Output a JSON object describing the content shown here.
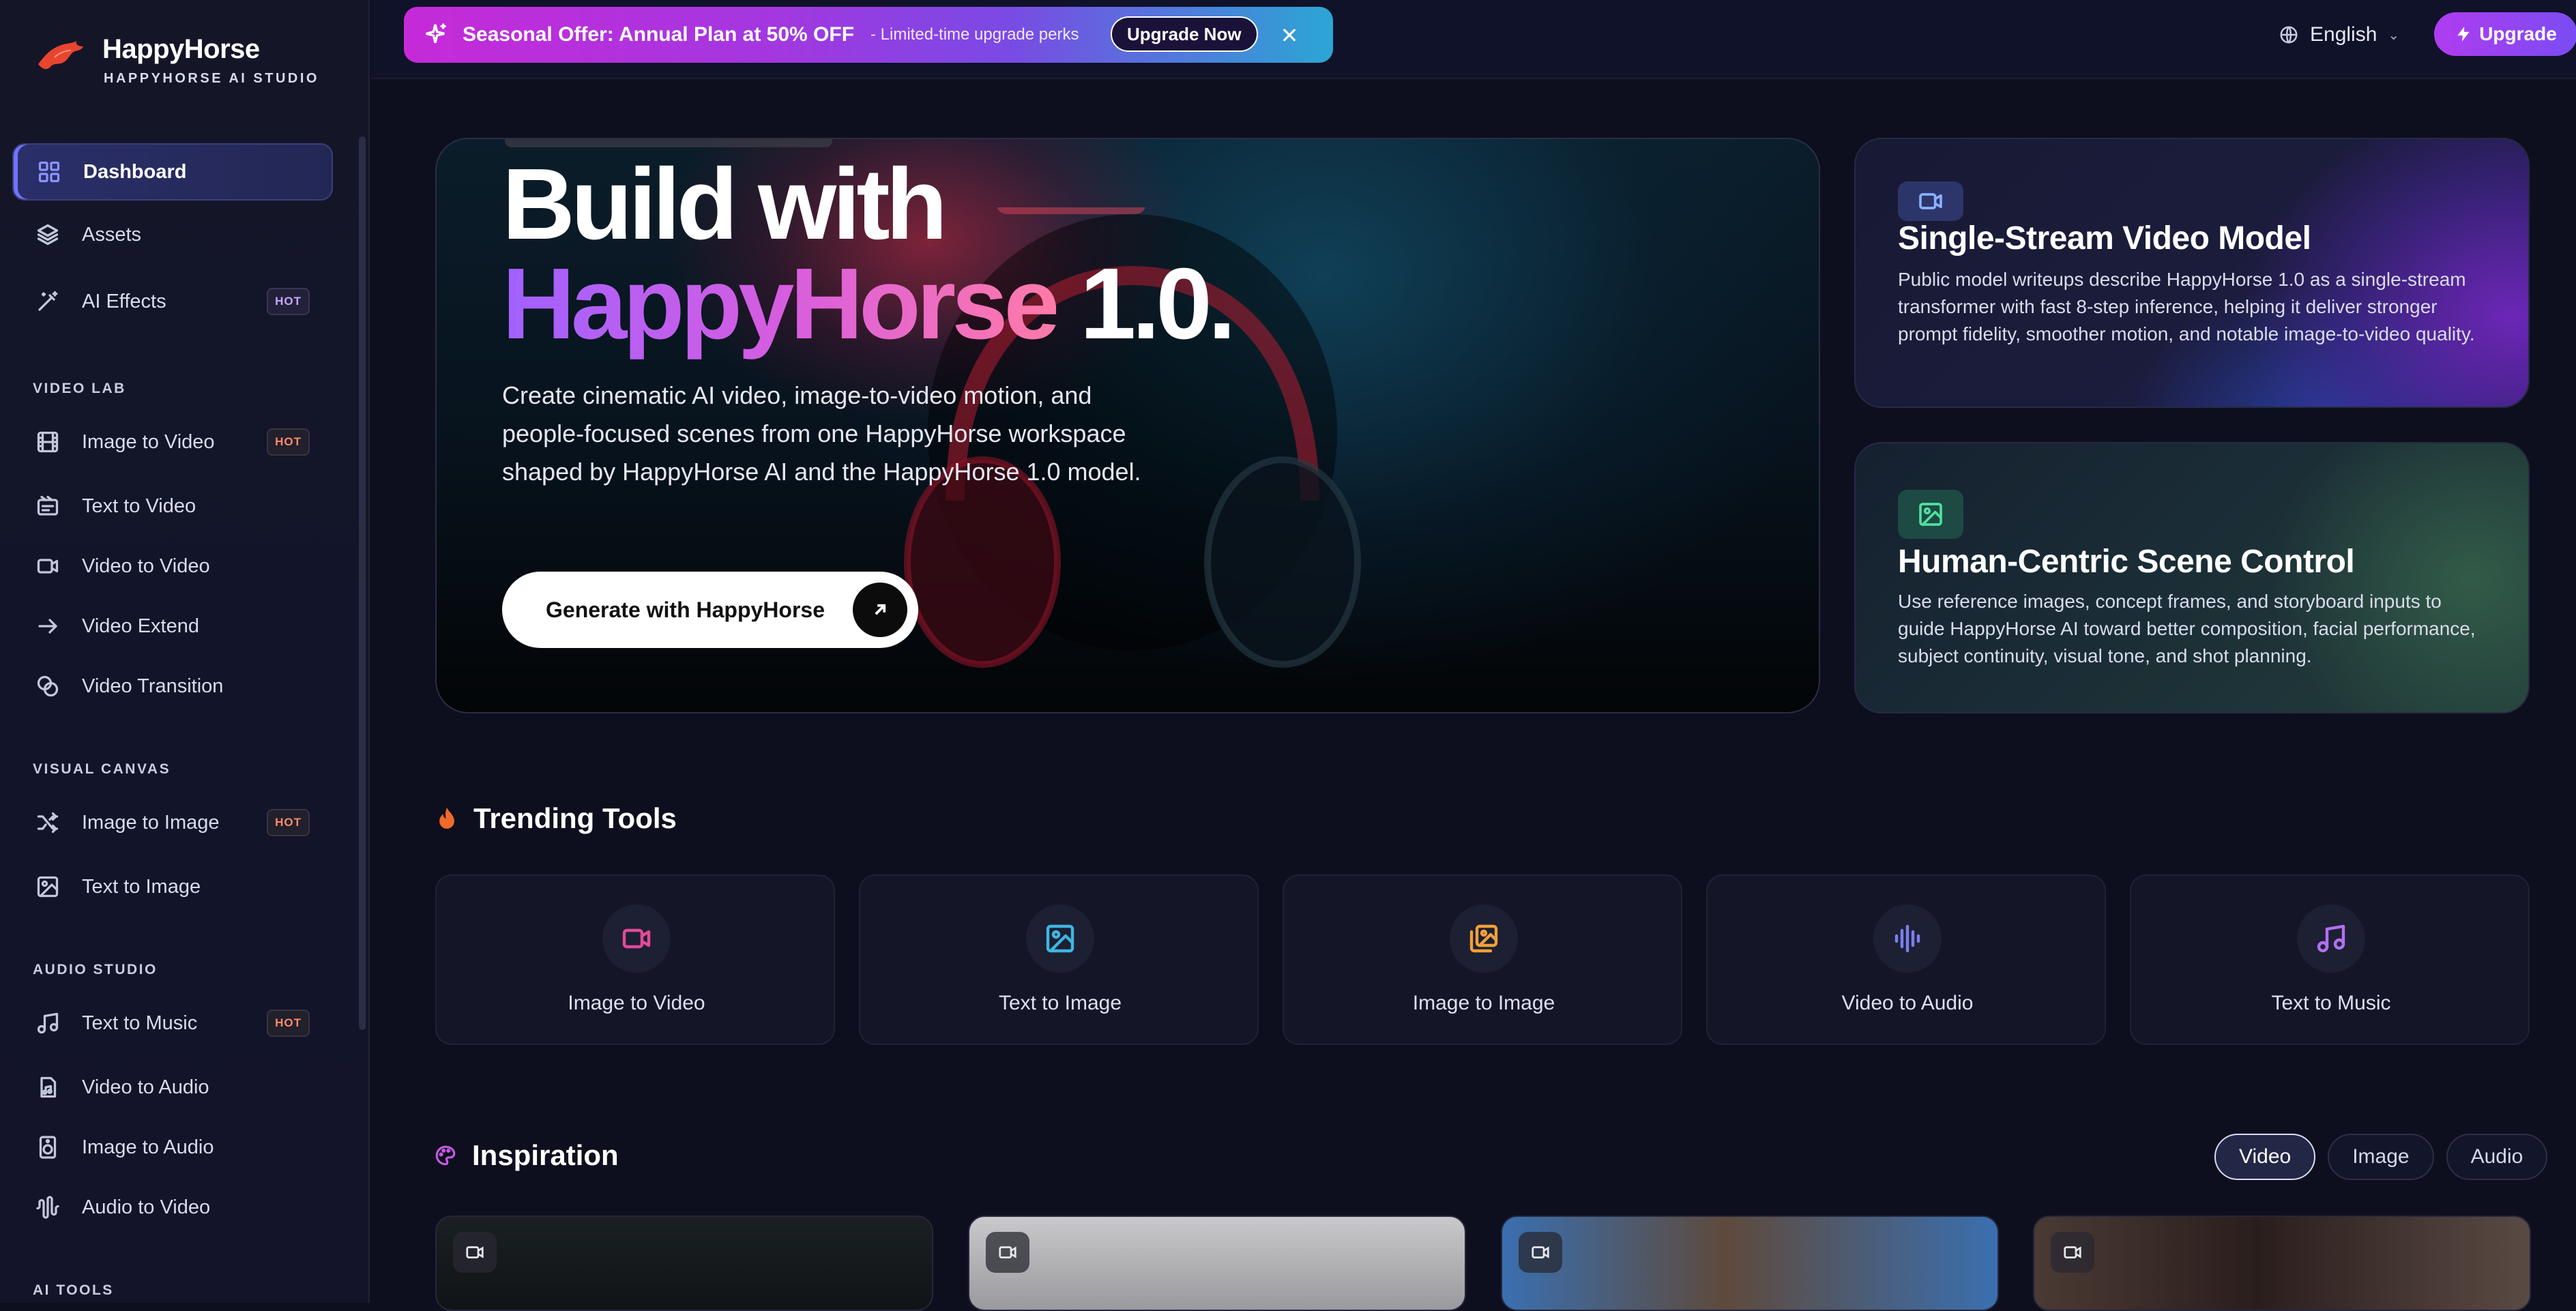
{
  "brand": {
    "name": "HappyHorse",
    "subtitle": "HAPPYHORSE AI STUDIO"
  },
  "sidebar": {
    "top_items": [
      {
        "label": "Dashboard",
        "icon": "grid-icon",
        "active": true
      },
      {
        "label": "Assets",
        "icon": "layers-icon"
      },
      {
        "label": "AI Effects",
        "icon": "wand-icon",
        "badge": "HOT"
      }
    ],
    "sections": [
      {
        "title": "VIDEO LAB",
        "items": [
          {
            "label": "Image to Video",
            "icon": "film-icon",
            "badge": "HOT"
          },
          {
            "label": "Text to Video",
            "icon": "text-video-icon"
          },
          {
            "label": "Video to Video",
            "icon": "video-camera-icon"
          },
          {
            "label": "Video Extend",
            "icon": "arrow-right-icon"
          },
          {
            "label": "Video Transition",
            "icon": "transition-icon"
          }
        ]
      },
      {
        "title": "VISUAL CANVAS",
        "items": [
          {
            "label": "Image to Image",
            "icon": "shuffle-icon",
            "badge": "HOT"
          },
          {
            "label": "Text to Image",
            "icon": "image-icon"
          }
        ]
      },
      {
        "title": "AUDIO STUDIO",
        "items": [
          {
            "label": "Text to Music",
            "icon": "music-note-icon",
            "badge": "HOT"
          },
          {
            "label": "Video to Audio",
            "icon": "audio-file-icon"
          },
          {
            "label": "Image to Audio",
            "icon": "speaker-icon"
          },
          {
            "label": "Audio to Video",
            "icon": "waveform-icon"
          }
        ]
      },
      {
        "title": "AI TOOLS",
        "items": []
      }
    ]
  },
  "topbar": {
    "promo_title": "Seasonal Offer: Annual Plan at 50% OFF",
    "promo_sub": "- Limited-time upgrade perks",
    "promo_cta": "Upgrade Now",
    "promo_close": "✕",
    "language": "English",
    "upgrade": "Upgrade"
  },
  "hero": {
    "title_line1": "Build with",
    "title_brand": "HappyHorse",
    "title_version": " 1.0.",
    "description": "Create cinematic AI video, image-to-video motion, and people-focused scenes from one HappyHorse workspace shaped by HappyHorse AI and the HappyHorse 1.0 model.",
    "cta": "Generate with HappyHorse"
  },
  "features": [
    {
      "title": "Single-Stream Video Model",
      "description": "Public model writeups describe HappyHorse 1.0 as a single-stream transformer with fast 8-step inference, helping it deliver stronger prompt fidelity, smoother motion, and notable image-to-video quality."
    },
    {
      "title": "Human-Centric Scene Control",
      "description": "Use reference images, concept frames, and storyboard inputs to guide HappyHorse AI toward better composition, facial performance, subject continuity, visual tone, and shot planning."
    }
  ],
  "trending": {
    "title": "Trending Tools",
    "tools": [
      {
        "label": "Image to Video",
        "icon": "video-camera-icon",
        "color": "#e24a9a"
      },
      {
        "label": "Text to Image",
        "icon": "image-icon",
        "color": "#3fb6e0"
      },
      {
        "label": "Image to Image",
        "icon": "images-icon",
        "color": "#f0a13a"
      },
      {
        "label": "Video to Audio",
        "icon": "waveform-icon",
        "color": "#7b7ff0"
      },
      {
        "label": "Text to Music",
        "icon": "music-note-icon",
        "color": "#b070f0"
      }
    ]
  },
  "inspiration": {
    "title": "Inspiration",
    "filters": [
      {
        "label": "Video",
        "active": true
      },
      {
        "label": "Image"
      },
      {
        "label": "Audio"
      }
    ]
  },
  "colors": {
    "accent": "#6f74ff",
    "hot_badge": "#ff8a6b",
    "promo_start": "#c62ad8",
    "promo_end": "#2ba6d4",
    "upgrade_button": "#9a44f2"
  }
}
